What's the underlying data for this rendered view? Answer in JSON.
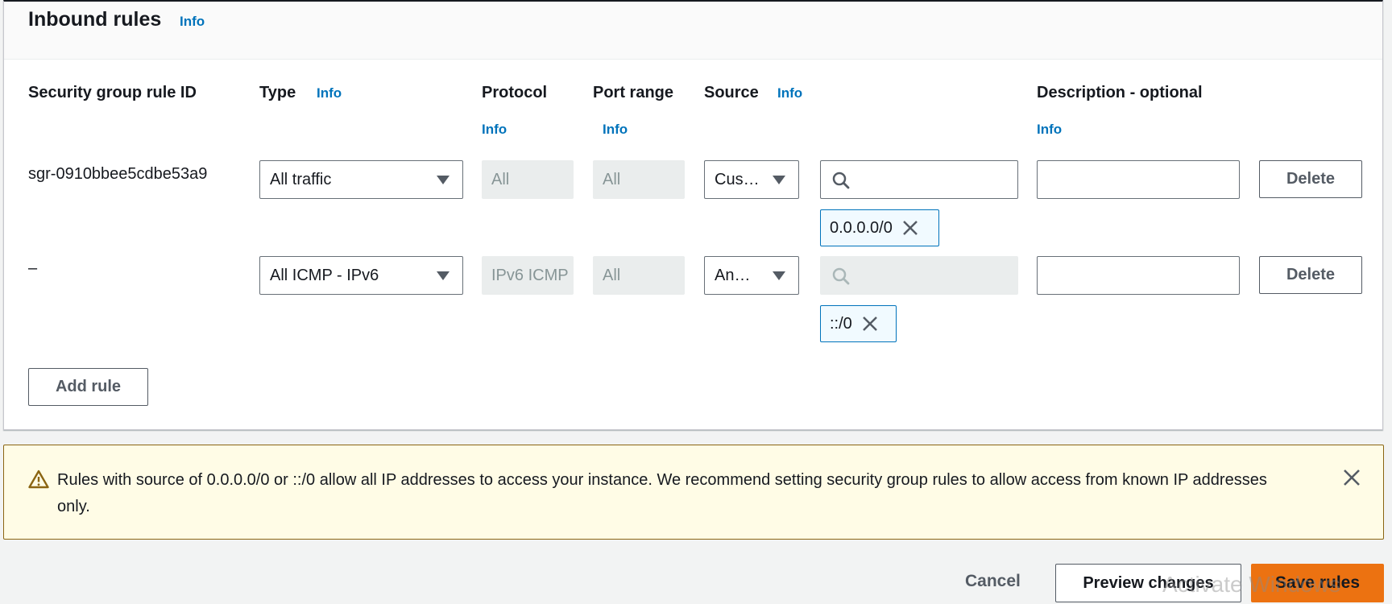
{
  "panel": {
    "title": "Inbound rules",
    "title_info": "Info"
  },
  "columns": {
    "rule_id": "Security group rule ID",
    "type": "Type",
    "type_info": "Info",
    "protocol": "Protocol",
    "protocol_info": "Info",
    "port_range": "Port range",
    "port_range_info": "Info",
    "source": "Source",
    "source_info": "Info",
    "description": "Description - optional",
    "description_info": "Info"
  },
  "rules": [
    {
      "id": "sgr-0910bbee5cdbe53a9",
      "type": "All traffic",
      "protocol": "All",
      "port_range": "All",
      "source_type": "Cus…",
      "source_token": "0.0.0.0/0",
      "description": "",
      "delete_label": "Delete"
    },
    {
      "id": "–",
      "type": "All ICMP - IPv6",
      "protocol": "IPv6 ICMP",
      "port_range": "All",
      "source_type": "An…",
      "source_token": "::/0",
      "description": "",
      "delete_label": "Delete"
    }
  ],
  "add_rule_label": "Add rule",
  "warning": {
    "text": "Rules with source of 0.0.0.0/0 or ::/0 allow all IP addresses to access your instance. We recommend setting security group rules to allow access from known IP addresses only."
  },
  "footer": {
    "cancel_label": "Cancel",
    "preview_label": "Preview changes",
    "save_label": "Save rules"
  },
  "watermark": "Activate Windows",
  "icons": [
    "search-icon",
    "chevron-down-icon",
    "close-icon",
    "warning-icon"
  ],
  "colors": {
    "accent": "#0073bb",
    "primary_button": "#ec7211",
    "warning_bg": "#fffce6",
    "warning_border": "#8b6512",
    "token_bg": "#f1faff"
  }
}
